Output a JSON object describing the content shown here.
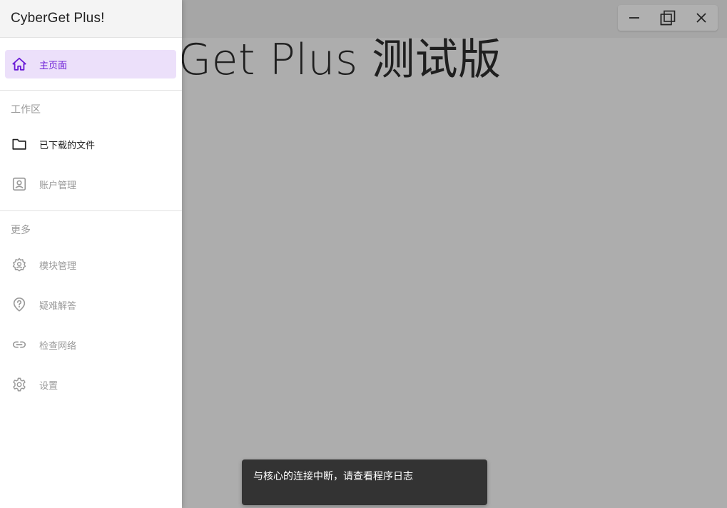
{
  "app": {
    "background_title": "CyberGet Plus 测试版"
  },
  "drawer": {
    "title": "CyberGet Plus!",
    "home": {
      "label": "主页面",
      "icon": "home-icon"
    },
    "sections": [
      {
        "header": "工作区",
        "items": [
          {
            "label": "已下载的文件",
            "icon": "folder-icon",
            "enabled": true
          },
          {
            "label": "账户管理",
            "icon": "account-box-icon",
            "enabled": false
          }
        ]
      },
      {
        "header": "更多",
        "items": [
          {
            "label": "模块管理",
            "icon": "module-gear-icon",
            "enabled": false
          },
          {
            "label": "疑难解答",
            "icon": "help-icon",
            "enabled": false
          },
          {
            "label": "检查网络",
            "icon": "link-icon",
            "enabled": false
          },
          {
            "label": "设置",
            "icon": "settings-icon",
            "enabled": false
          }
        ]
      }
    ]
  },
  "window_controls": {
    "minimize_icon": "minimize-icon",
    "maximize_icon": "maximize-icon",
    "close_icon": "close-icon"
  },
  "snackbar": {
    "message": "与核心的连接中断，请查看程序日志"
  },
  "colors": {
    "accent": "#6a1bd6",
    "active_bg": "#ece0fa",
    "scrim": "#adadad",
    "snackbar_bg": "#333333"
  }
}
